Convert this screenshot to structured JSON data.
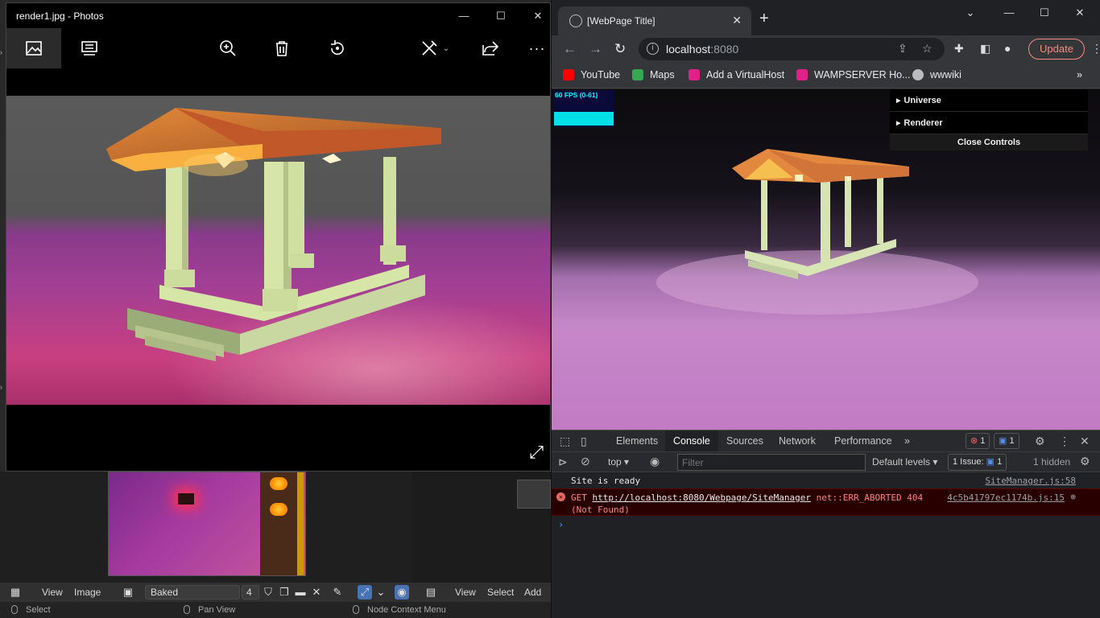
{
  "blender": {
    "header": {
      "view": "View",
      "image": "Image",
      "image_name": "Baked",
      "users_count": "4",
      "node_view": "View",
      "node_select": "Select",
      "node_add": "Add"
    },
    "status": {
      "select": "Select",
      "pan_view": "Pan View",
      "node_context_menu": "Node Context Menu"
    }
  },
  "photos": {
    "title": "render1.jpg - Photos",
    "toolbar": [
      "image-view-icon",
      "slideshow-icon",
      "zoom-in-icon",
      "delete-icon",
      "rotate-icon",
      "edit-icon",
      "share-icon",
      "more-icon"
    ]
  },
  "chrome": {
    "tab_title": "[WebPage Title]",
    "url_host": "localhost",
    "url_port": ":8080",
    "update_label": "Update",
    "bookmarks": [
      {
        "label": "YouTube",
        "color": "#ff0000"
      },
      {
        "label": "Maps",
        "color": "#34a853"
      },
      {
        "label": "Add a VirtualHost",
        "color": "#e0218a"
      },
      {
        "label": "WAMPSERVER Ho...",
        "color": "#e0218a"
      },
      {
        "label": "wwwiki",
        "color": "#bbbbbb"
      }
    ],
    "stats": {
      "fps": "60 FPS (0-61)"
    },
    "gui": {
      "universe": "Universe",
      "renderer": "Renderer",
      "close": "Close Controls"
    }
  },
  "devtools": {
    "tabs": [
      "Elements",
      "Console",
      "Sources",
      "Network",
      "Performance"
    ],
    "errors_count": "1",
    "messages_count": "1",
    "context": "top",
    "filter_placeholder": "Filter",
    "levels": "Default levels",
    "issues_label": "1 Issue:",
    "issues_count": "1",
    "hidden": "1 hidden",
    "logs": [
      {
        "text": "Site is ready",
        "source": "SiteManager.js:58"
      },
      {
        "method": "GET",
        "url": "http://localhost:8080/Webpage/SiteManager",
        "status": "net::ERR_ABORTED 404",
        "detail": "(Not Found)",
        "source": "4c5b41797ec1174b.js:15"
      }
    ]
  }
}
